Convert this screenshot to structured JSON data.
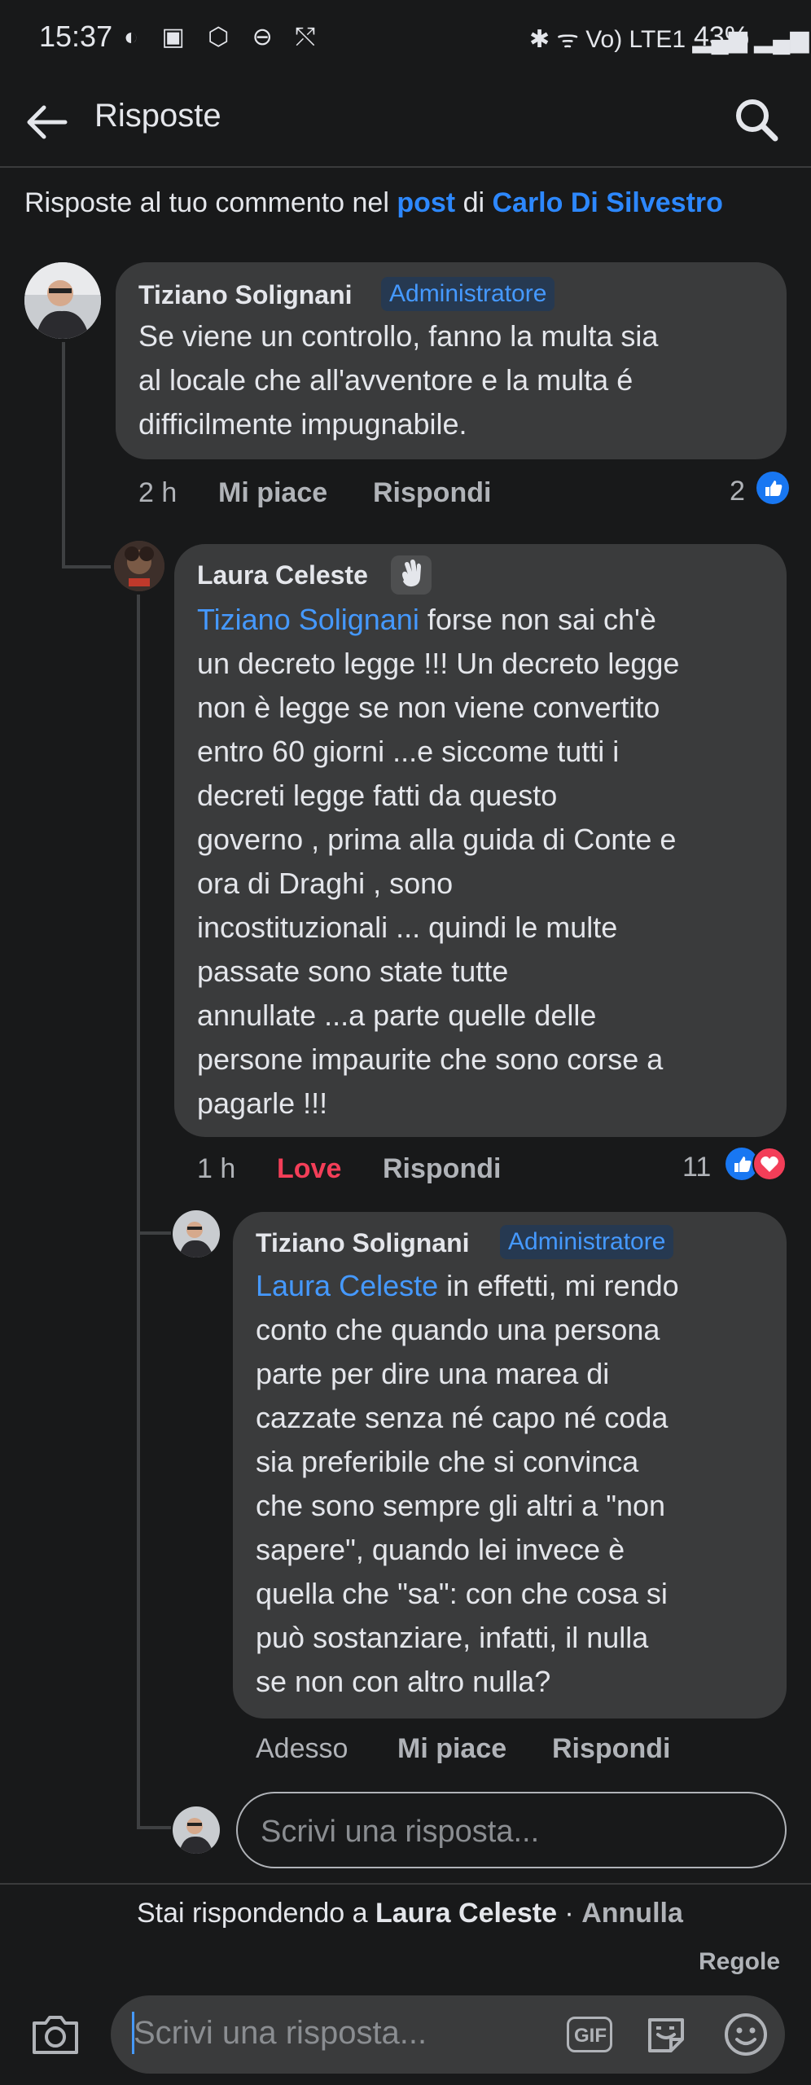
{
  "status_bar": {
    "time": "15:37",
    "left_icons": "◐ ▣ ⬡ ⊖ ⤲",
    "right_icons": "✱ ᯤ Vo) LTE1 ▂▄▆ ▂▄▆",
    "battery": "43%"
  },
  "header": {
    "title": "Risposte",
    "back_icon": "arrow-left-icon",
    "search_icon": "search-icon"
  },
  "context": {
    "prefix": "Risposte al tuo commento nel ",
    "post_link": "post",
    "middle": " di ",
    "author_link": "Carlo Di Silvestro"
  },
  "comments": [
    {
      "author": "Tiziano Solignani",
      "badge": "Administratore",
      "lines": [
        "Se viene un controllo, fanno la multa sia",
        "al locale che all'avventore e la multa é",
        "difficilmente impugnabile."
      ],
      "time": "2 h",
      "like": "Mi piace",
      "reply": "Rispondi",
      "reactions": "2"
    },
    {
      "author": "Laura Celeste",
      "mention": "Tiziano Solignani",
      "first_line_rest": " forse non sai ch'è",
      "lines": [
        "un decreto legge !!! Un decreto legge",
        "non è legge se non viene convertito",
        "entro 60 giorni ...e siccome tutti i",
        "decreti legge fatti da questo",
        "governo , prima alla guida di Conte e",
        "ora di Draghi , sono",
        "incostituzionali ... quindi le multe",
        "passate sono state tutte",
        "annullate ...a parte quelle delle",
        "persone impaurite che sono corse a",
        "pagarle !!!"
      ],
      "time": "1 h",
      "like": "Love",
      "reply": "Rispondi",
      "reactions": "11"
    },
    {
      "author": "Tiziano Solignani",
      "badge": "Administratore",
      "mention": "Laura Celeste",
      "first_line_rest": " in effetti, mi rendo",
      "lines": [
        "conto che quando una persona",
        "parte per dire una marea di",
        "cazzate senza né capo né coda",
        "sia preferibile che si convinca",
        "che sono sempre gli altri a \"non",
        "sapere\", quando lei invece è",
        "quella che \"sa\": con che cosa si",
        "può sostanziare, infatti, il nulla",
        "se non con altro nulla?"
      ],
      "time": "Adesso",
      "like": "Mi piace",
      "reply": "Rispondi"
    }
  ],
  "reply_input_placeholder": "Scrivi una risposta...",
  "footer": {
    "replying_prefix": "Stai rispondendo a ",
    "replying_name": "Laura Celeste",
    "separator": " · ",
    "cancel": "Annulla",
    "rules": "Regole",
    "composer_placeholder": "Scrivi una risposta...",
    "gif_label": "GIF"
  },
  "colors": {
    "background": "#18191a",
    "bubble": "#3a3b3c",
    "link": "#2d88ff",
    "love": "#f33e58",
    "like_blue": "#1877f2"
  }
}
